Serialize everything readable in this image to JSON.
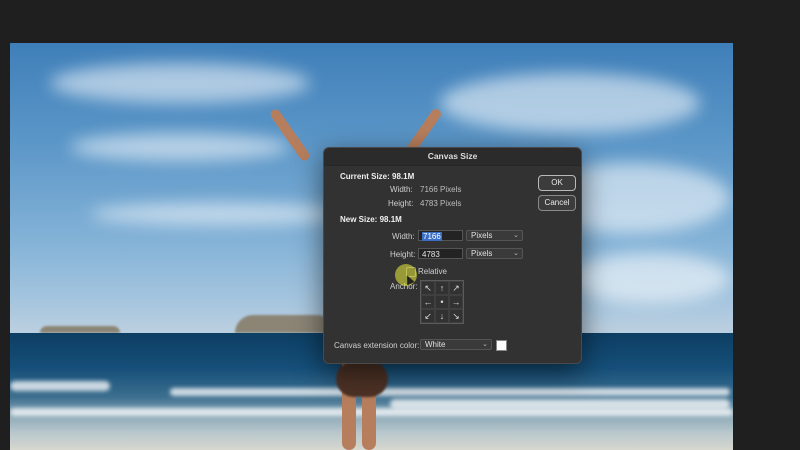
{
  "dialog": {
    "title": "Canvas Size",
    "current_size": {
      "label": "Current Size: 98.1M",
      "width_label": "Width:",
      "width_value": "7166 Pixels",
      "height_label": "Height:",
      "height_value": "4783 Pixels"
    },
    "new_size": {
      "label": "New Size: 98.1M",
      "width_label": "Width:",
      "width_value": "7166",
      "width_unit": "Pixels",
      "height_label": "Height:",
      "height_value": "4783",
      "height_unit": "Pixels",
      "relative_label": "Relative",
      "relative_checked": false,
      "anchor_label": "Anchor:",
      "anchor_arrows": [
        "↖",
        "↑",
        "↗",
        "←",
        "•",
        "→",
        "↙",
        "↓",
        "↘"
      ]
    },
    "extension": {
      "label": "Canvas extension color:",
      "value": "White",
      "swatch_color": "#ffffff"
    },
    "ok_label": "OK",
    "cancel_label": "Cancel"
  }
}
